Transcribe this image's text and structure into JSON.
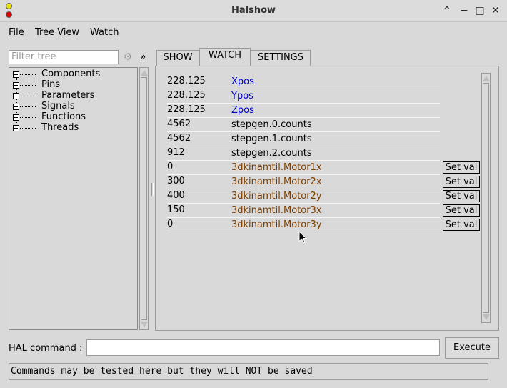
{
  "window": {
    "title": "Halshow"
  },
  "menu": [
    "File",
    "Tree View",
    "Watch"
  ],
  "filter": {
    "placeholder": "Filter tree"
  },
  "expand_label": "»",
  "tree": [
    "Components",
    "Pins",
    "Parameters",
    "Signals",
    "Functions",
    "Threads"
  ],
  "tabs": [
    {
      "label": "SHOW",
      "active": false
    },
    {
      "label": "WATCH",
      "active": true
    },
    {
      "label": "SETTINGS",
      "active": false
    }
  ],
  "watch": {
    "rows": [
      {
        "value": "228.125",
        "name": "Xpos",
        "type": "float",
        "setval": false
      },
      {
        "value": "228.125",
        "name": "Ypos",
        "type": "float",
        "setval": false
      },
      {
        "value": "228.125",
        "name": "Zpos",
        "type": "float",
        "setval": false
      },
      {
        "value": "4562",
        "name": "stepgen.0.counts",
        "type": "u32",
        "setval": false
      },
      {
        "value": "4562",
        "name": "stepgen.1.counts",
        "type": "u32",
        "setval": false
      },
      {
        "value": "912",
        "name": "stepgen.2.counts",
        "type": "u32",
        "setval": false
      },
      {
        "value": "0",
        "name": "3dkinamtil.Motor1x",
        "type": "s32",
        "setval": true
      },
      {
        "value": "300",
        "name": "3dkinamtil.Motor2x",
        "type": "s32",
        "setval": true
      },
      {
        "value": "400",
        "name": "3dkinamtil.Motor2y",
        "type": "s32",
        "setval": true
      },
      {
        "value": "150",
        "name": "3dkinamtil.Motor3x",
        "type": "s32",
        "setval": true
      },
      {
        "value": "0",
        "name": "3dkinamtil.Motor3y",
        "type": "s32",
        "setval": true
      }
    ],
    "setval_label": "Set val",
    "colors": {
      "float": "#0000c8",
      "u32": "#000000",
      "s32": "#7a3d00"
    }
  },
  "halcmd": {
    "label": "HAL command :",
    "value": "",
    "execute_label": "Execute"
  },
  "status": "Commands may be tested here but they will NOT be saved"
}
